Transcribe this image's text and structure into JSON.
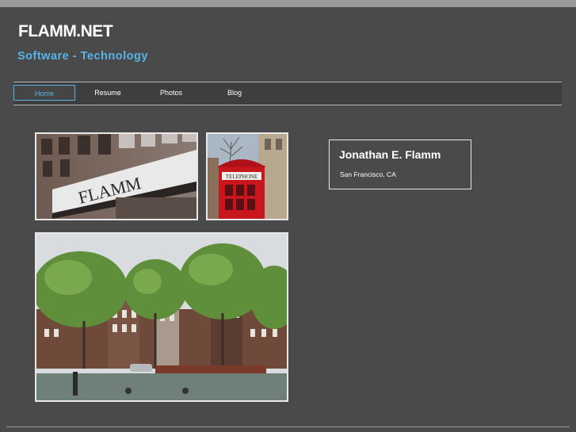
{
  "header": {
    "title": "FLAMM.NET",
    "tagline": "Software - Technology"
  },
  "nav": {
    "items": [
      {
        "label": "Home",
        "active": true
      },
      {
        "label": "Resume",
        "active": false
      },
      {
        "label": "Photos",
        "active": false
      },
      {
        "label": "Blog",
        "active": false
      }
    ]
  },
  "photos": {
    "storefront_sign": "FLAMM",
    "phonebooth_sign": "TELEPHONE"
  },
  "profile": {
    "name": "Jonathan E. Flamm",
    "location": "San Francisco, CA"
  },
  "colors": {
    "background": "#4a4a4a",
    "accent": "#56b4e6",
    "nav_background": "#3e3e3e",
    "border": "#e8e8e8"
  }
}
